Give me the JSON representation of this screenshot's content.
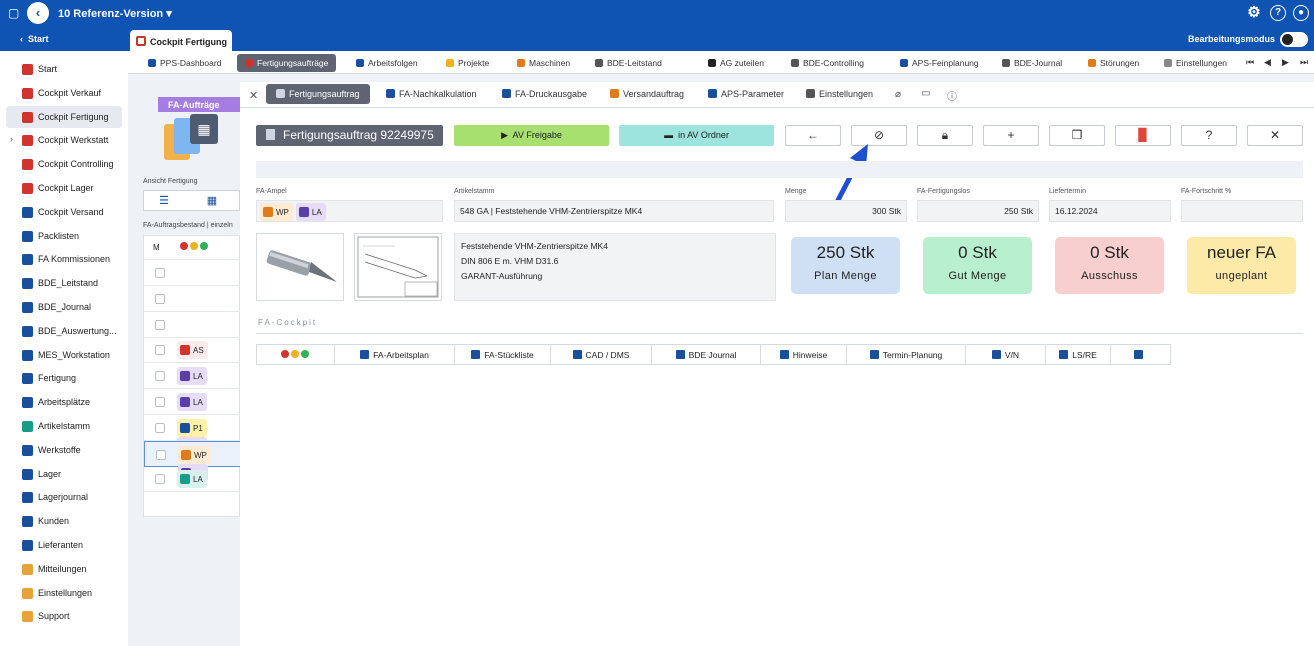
{
  "app": {
    "version_title": "10 Referenz-Version",
    "chevron": "▾",
    "top_icons": [
      "gear-icon",
      "help-icon",
      "user-icon"
    ]
  },
  "nav2": {
    "start_label": "Start",
    "active_tab": "Cockpit Fertigung",
    "mode_label": "Bearbeitungsmodus"
  },
  "sidebar": {
    "items": [
      {
        "label": "Start",
        "color": "#d0342c"
      },
      {
        "label": "Cockpit Verkauf",
        "color": "#d0342c"
      },
      {
        "label": "Cockpit Fertigung",
        "color": "#d0342c"
      },
      {
        "label": "Cockpit Werkstatt",
        "color": "#d0342c"
      },
      {
        "label": "Cockpit Controlling",
        "color": "#d0342c"
      },
      {
        "label": "Cockpit Lager",
        "color": "#d0342c"
      },
      {
        "label": "Cockpit Versand",
        "color": "#1a4f9c"
      },
      {
        "label": "Packlisten",
        "color": "#1a4f9c"
      },
      {
        "label": "FA Kommissionen",
        "color": "#1a4f9c"
      },
      {
        "label": "BDE_Leitstand",
        "color": "#1a4f9c"
      },
      {
        "label": "BDE_Journal",
        "color": "#1a4f9c"
      },
      {
        "label": "BDE_Auswertung...",
        "color": "#1a4f9c"
      },
      {
        "label": "MES_Workstation",
        "color": "#1a4f9c"
      },
      {
        "label": "Fertigung",
        "color": "#1a4f9c"
      },
      {
        "label": "Arbeitsplätze",
        "color": "#1a4f9c"
      },
      {
        "label": "Artikelstamm",
        "color": "#1a9c8a"
      },
      {
        "label": "Werkstoffe",
        "color": "#1a4f9c"
      },
      {
        "label": "Lager",
        "color": "#1a4f9c"
      },
      {
        "label": "Lagerjournal",
        "color": "#1a4f9c"
      },
      {
        "label": "Kunden",
        "color": "#1a4f9c"
      },
      {
        "label": "Lieferanten",
        "color": "#1a4f9c"
      },
      {
        "label": "Mitteilungen",
        "color": "#e8a23a"
      },
      {
        "label": "Einstellungen",
        "color": "#e8a23a"
      },
      {
        "label": "Support",
        "color": "#e8a23a"
      }
    ]
  },
  "tabs1": [
    {
      "label": "PPS-Dashboard"
    },
    {
      "label": "Fertigungsaufträge"
    },
    {
      "label": "Arbeitsfolgen"
    },
    {
      "label": "Projekte"
    },
    {
      "label": "Maschinen"
    },
    {
      "label": "BDE-Leitstand"
    },
    {
      "label": "AG  zuteilen"
    },
    {
      "label": "BDE-Controlling"
    },
    {
      "label": "APS-Feinplanung"
    },
    {
      "label": "BDE-Journal"
    },
    {
      "label": "Störungen"
    },
    {
      "label": "Einstellungen"
    }
  ],
  "leftpanel": {
    "title": "FA-Aufträge",
    "view_label": "Ansicht Fertigung",
    "bestand_label": "FA-Auftragsbestand | einzeln",
    "col_m": "M",
    "rows": [
      {
        "tags": []
      },
      {
        "tags": []
      },
      {
        "tags": []
      },
      {
        "tags": [
          {
            "label": "AS",
            "bg": "#fdeaea",
            "icon": "hand-icon",
            "ic": "#d0342c"
          }
        ]
      },
      {
        "tags": [
          {
            "label": "LA",
            "bg": "#e6dcf7",
            "icon": "matrix-icon",
            "ic": "#5a3fa8"
          }
        ]
      },
      {
        "tags": [
          {
            "label": "LA",
            "bg": "#e6dcf7",
            "icon": "matrix-icon",
            "ic": "#5a3fa8"
          }
        ]
      },
      {
        "tags": [
          {
            "label": "P1",
            "bg": "#fff1a8",
            "icon": "star-icon",
            "ic": "#1a4f9c"
          },
          {
            "label": "LA",
            "bg": "#e6dcf7",
            "icon": "matrix-icon",
            "ic": "#5a3fa8"
          }
        ]
      },
      {
        "tags": [
          {
            "label": "WP",
            "bg": "#fdebd3",
            "icon": "tools-icon",
            "ic": "#e07b1a"
          },
          {
            "label": "LA",
            "bg": "#e6dcf7",
            "icon": "matrix-icon",
            "ic": "#5a3fa8"
          }
        ]
      },
      {
        "tags": [
          {
            "label": "LA",
            "bg": "#d9f1ec",
            "icon": "calendar-icon",
            "ic": "#1a9c8a"
          }
        ]
      }
    ]
  },
  "tabs2": [
    {
      "label": "Fertigungsauftrag"
    },
    {
      "label": "FA-Nachkalkulation"
    },
    {
      "label": "FA-Druckausgabe"
    },
    {
      "label": "Versandauftrag"
    },
    {
      "label": "APS-Parameter"
    },
    {
      "label": "Einstellungen"
    }
  ],
  "actions": {
    "fa_title": "Fertigungsauftrag 92249975",
    "av_freigabe": "AV Freigabe",
    "av_ordner": "in AV Ordner",
    "colors": {
      "title_bg": "#5f6472",
      "green": "#a8e070",
      "teal": "#9ee4de"
    }
  },
  "fields": {
    "ampel_label": "FA-Ampel",
    "ampel_tags": [
      {
        "label": "WP",
        "bg": "#fdebd3"
      },
      {
        "label": "LA",
        "bg": "#e6dcf7"
      }
    ],
    "artikel_label": "Artikelstamm",
    "artikel_value": "548 GA | Feststehende VHM-Zentrierspitze MK4",
    "menge_label": "Menge",
    "menge_value": "300 Stk",
    "los_label": "FA-Fertigungslos",
    "los_value": "250 Stk",
    "liefer_label": "Liefertermin",
    "liefer_value": "16.12.2024",
    "fortschritt_label": "FA-Fortschritt %",
    "fortschritt_value": ""
  },
  "description": {
    "line1": "Feststehende VHM-Zentrierspitze MK4",
    "line2": "DIN 806 E m. VHM D31.6",
    "line3": "GARANT-Ausführung"
  },
  "cards": [
    {
      "value": "250 Stk",
      "label": "Plan Menge",
      "bg": "#cfe0f5"
    },
    {
      "value": "0 Stk",
      "label": "Gut Menge",
      "bg": "#b8efcf"
    },
    {
      "value": "0 Stk",
      "label": "Ausschuss",
      "bg": "#f7cfcf"
    },
    {
      "value": "neuer FA",
      "label": "ungeplant",
      "bg": "#fde9a8"
    }
  ],
  "cockpit": {
    "section_label": "FA-Cockpit",
    "buttons": [
      {
        "label": "FA-Arbeitsplan",
        "icon": "document-icon"
      },
      {
        "label": "FA-Stückliste",
        "icon": "tree-icon"
      },
      {
        "label": "CAD / DMS",
        "icon": "cad-icon"
      },
      {
        "label": "BDE Journal",
        "icon": "clock-icon"
      },
      {
        "label": "Hinweise",
        "icon": "message-icon"
      },
      {
        "label": "Termin-Planung",
        "icon": "calendar-icon"
      },
      {
        "label": "V/N",
        "icon": "swap-icon"
      },
      {
        "label": "LS/RE",
        "icon": "truck-icon"
      },
      {
        "label": "",
        "icon": "chart-icon"
      }
    ]
  }
}
